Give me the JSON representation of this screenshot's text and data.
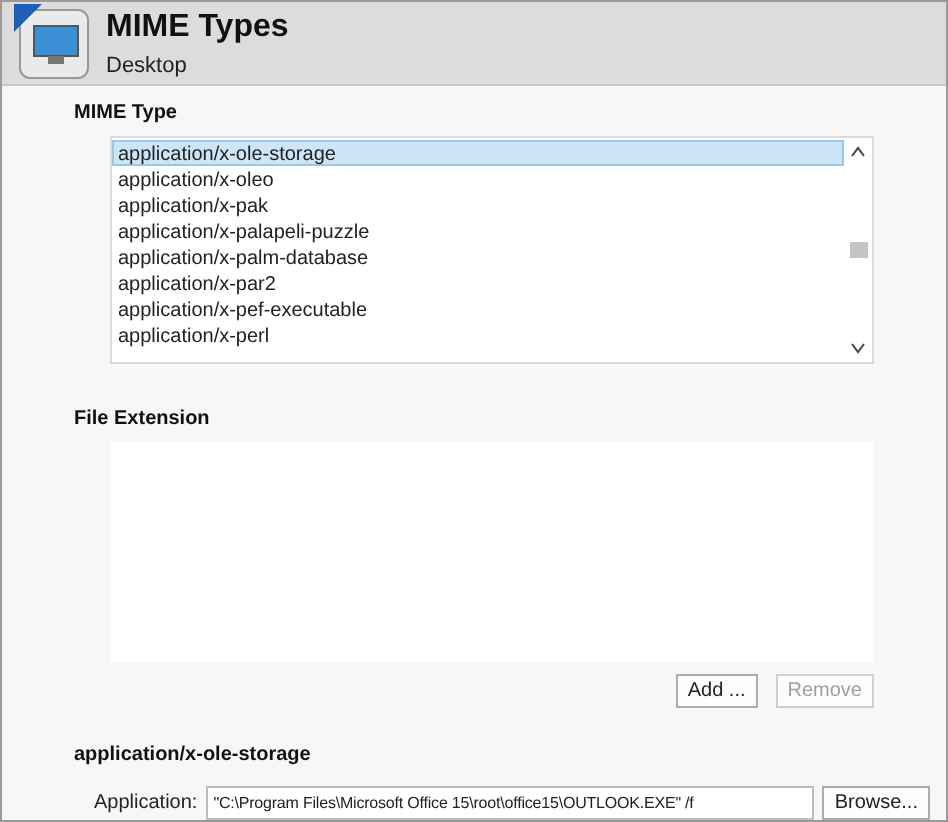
{
  "header": {
    "title": "MIME Types",
    "subtitle": "Desktop"
  },
  "mime_type": {
    "label": "MIME Type",
    "items": [
      {
        "label": "application/x-ole-storage",
        "selected": true
      },
      {
        "label": "application/x-oleo",
        "selected": false
      },
      {
        "label": "application/x-pak",
        "selected": false
      },
      {
        "label": "application/x-palapeli-puzzle",
        "selected": false
      },
      {
        "label": "application/x-palm-database",
        "selected": false
      },
      {
        "label": "application/x-par2",
        "selected": false
      },
      {
        "label": "application/x-pef-executable",
        "selected": false
      },
      {
        "label": "application/x-perl",
        "selected": false
      }
    ]
  },
  "file_extension": {
    "label": "File Extension",
    "buttons": [
      {
        "label": "Add ...",
        "disabled": false
      },
      {
        "label": "Remove",
        "disabled": true
      }
    ]
  },
  "details": {
    "title": "application/x-ole-storage",
    "application_label": "Application:",
    "application_value": "\"C:\\Program Files\\Microsoft Office 15\\root\\office15\\OUTLOOK.EXE\" /f",
    "browse": "Browse..."
  }
}
